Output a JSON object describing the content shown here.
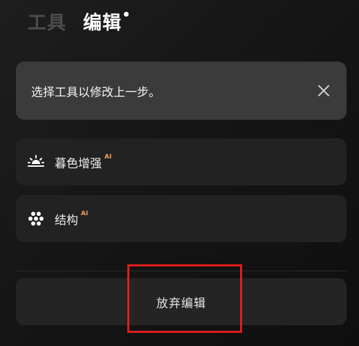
{
  "tabs": [
    {
      "label": "工具",
      "active": false
    },
    {
      "label": "编辑",
      "active": true
    }
  ],
  "hint": {
    "text": "选择工具以修改上一步。",
    "close_icon": "close-icon"
  },
  "tools": [
    {
      "label": "暮色增强",
      "badge": "AI",
      "icon": "sunset-icon"
    },
    {
      "label": "结构",
      "badge": "AI",
      "icon": "dots-cluster-icon"
    }
  ],
  "discard": {
    "label": "放弃编辑"
  },
  "colors": {
    "accent_badge": "#f0a060",
    "highlight": "#e31c1c",
    "background": "#151515"
  }
}
